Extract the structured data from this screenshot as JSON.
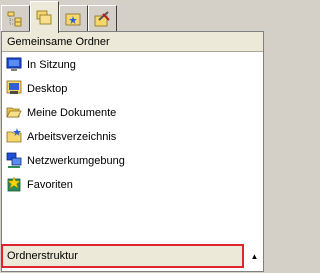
{
  "tabs": [
    {
      "icon": "folder-tree-icon"
    },
    {
      "icon": "folders-icon"
    },
    {
      "icon": "folder-star-icon"
    },
    {
      "icon": "folder-tools-icon"
    }
  ],
  "panel": {
    "header": "Gemeinsame Ordner",
    "items": [
      {
        "label": "In Sitzung",
        "icon": "monitor-icon"
      },
      {
        "label": "Desktop",
        "icon": "desktop-icon"
      },
      {
        "label": "Meine Dokumente",
        "icon": "open-folder-icon"
      },
      {
        "label": "Arbeitsverzeichnis",
        "icon": "folder-star-icon"
      },
      {
        "label": "Netzwerkumgebung",
        "icon": "network-icon"
      },
      {
        "label": "Favoriten",
        "icon": "favorites-icon"
      }
    ],
    "footer": "Ordnerstruktur",
    "footer_arrow": "▲"
  }
}
